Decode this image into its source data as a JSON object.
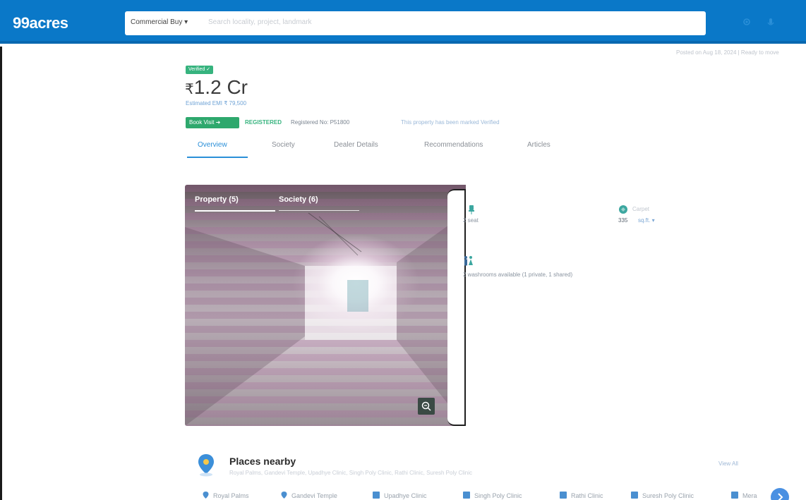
{
  "header": {
    "logo": "99acres",
    "search_category": "Commercial Buy",
    "search_placeholder": "Search locality, project, landmark",
    "icons": [
      "location-icon",
      "microphone-icon",
      "search-icon"
    ]
  },
  "listing": {
    "breadcrumb": "",
    "posted_text": "",
    "updated_text": "Posted on Aug 18, 2024 | Ready to move",
    "verified_label": "Verified",
    "price": "1.2 Cr",
    "currency": "₹",
    "price_note": "",
    "emi_text": "Estimated EMI ₹ 79,500",
    "book_visit_label": "Book Visit",
    "rera_label": "REGISTERED",
    "registration_text": "Registered No: P51800",
    "mark_text": "This property has been marked Verified"
  },
  "tabs": [
    "Overview",
    "Society",
    "Dealer Details",
    "Recommendations",
    "Articles"
  ],
  "gallery": {
    "tabs": [
      "Property (5)",
      "Society (6)"
    ],
    "active_tab": "Property (5)"
  },
  "features": {
    "seats": {
      "value": "2 seat"
    },
    "carpet": {
      "label": "Carpet",
      "value": "335",
      "unit": "sq.ft."
    },
    "washrooms": {
      "value": "2 washrooms available (1 private, 1 shared)"
    }
  },
  "places": {
    "title": "Places nearby",
    "list_text": "Royal Palms, Gandevi Temple, Upadhye Clinic, Singh Poly Clinic, Rathi Clinic, Suresh Poly Clinic",
    "view_all": "View All",
    "chips": [
      {
        "label": "Royal Palms",
        "icon": "location-icon"
      },
      {
        "label": "Gandevi Temple",
        "icon": "location-icon"
      },
      {
        "label": "Upadhye Clinic",
        "icon": "clinic-icon"
      },
      {
        "label": "Singh Poly Clinic",
        "icon": "clinic-icon"
      },
      {
        "label": "Rathi Clinic",
        "icon": "clinic-icon"
      },
      {
        "label": "Suresh Poly Clinic",
        "icon": "clinic-icon"
      },
      {
        "label": "Mera",
        "icon": "clinic-icon"
      }
    ]
  },
  "colors": {
    "header": "#0a78c8",
    "accent": "#2a8fd8",
    "green": "#2ea86d"
  }
}
